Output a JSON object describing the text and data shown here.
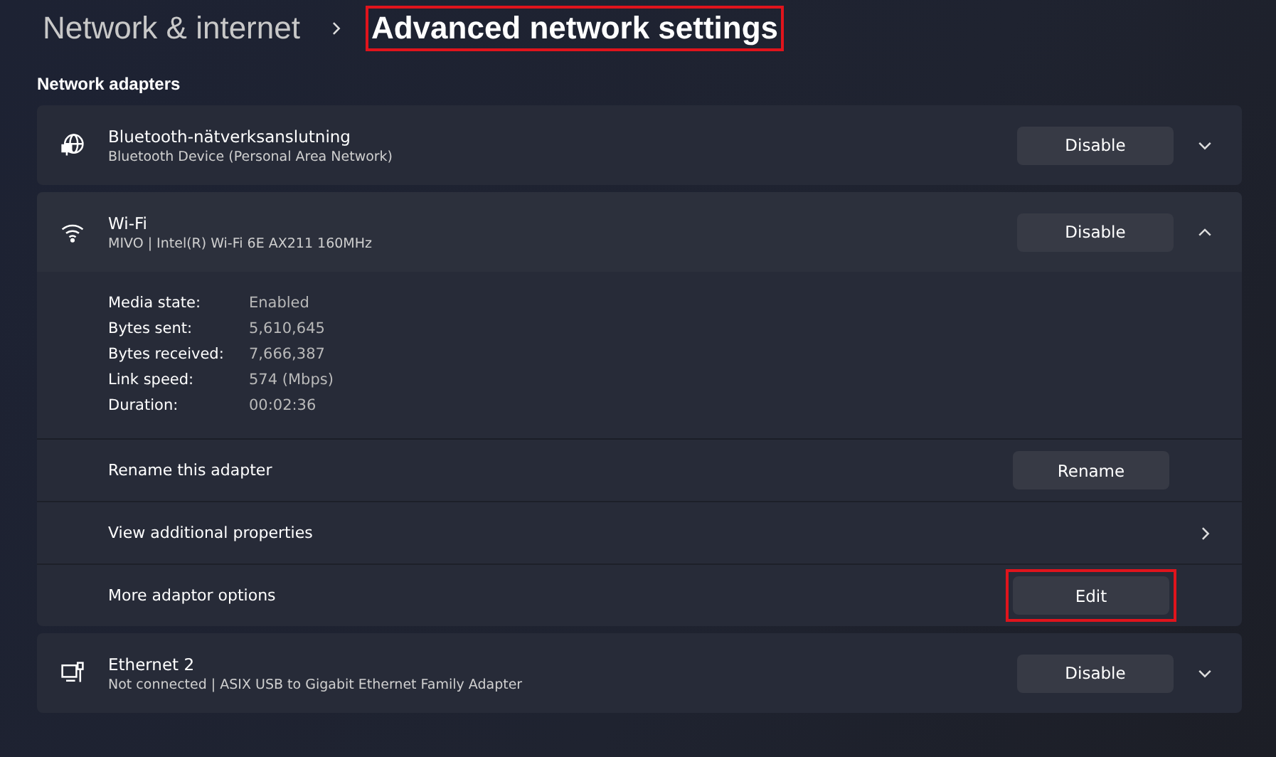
{
  "breadcrumb": [
    {
      "label": "Network & internet",
      "current": false,
      "highlighted": false
    },
    {
      "label": "Advanced network settings",
      "current": true,
      "highlighted": true
    }
  ],
  "section_title": "Network adapters",
  "adapters": [
    {
      "kind": "bluetooth",
      "name": "Bluetooth-nätverksanslutning",
      "description": "Bluetooth Device (Personal Area Network)",
      "action": "Disable",
      "expanded": false
    },
    {
      "kind": "wifi",
      "name": "Wi-Fi",
      "description": "MIVO | Intel(R) Wi-Fi 6E AX211 160MHz",
      "action": "Disable",
      "expanded": true,
      "details": [
        {
          "label": "Media state:",
          "value": "Enabled"
        },
        {
          "label": "Bytes sent:",
          "value": "5,610,645"
        },
        {
          "label": "Bytes received:",
          "value": "7,666,387"
        },
        {
          "label": "Link speed:",
          "value": "574 (Mbps)"
        },
        {
          "label": "Duration:",
          "value": "00:02:36"
        }
      ],
      "options": [
        {
          "kind": "button",
          "label": "Rename this adapter",
          "button": "Rename",
          "highlighted": false
        },
        {
          "kind": "link",
          "label": "View additional properties"
        },
        {
          "kind": "button",
          "label": "More adaptor options",
          "button": "Edit",
          "highlighted": true
        }
      ]
    },
    {
      "kind": "ethernet",
      "name": "Ethernet 2",
      "description": "Not connected | ASIX USB to Gigabit Ethernet Family Adapter",
      "action": "Disable",
      "expanded": false
    }
  ]
}
